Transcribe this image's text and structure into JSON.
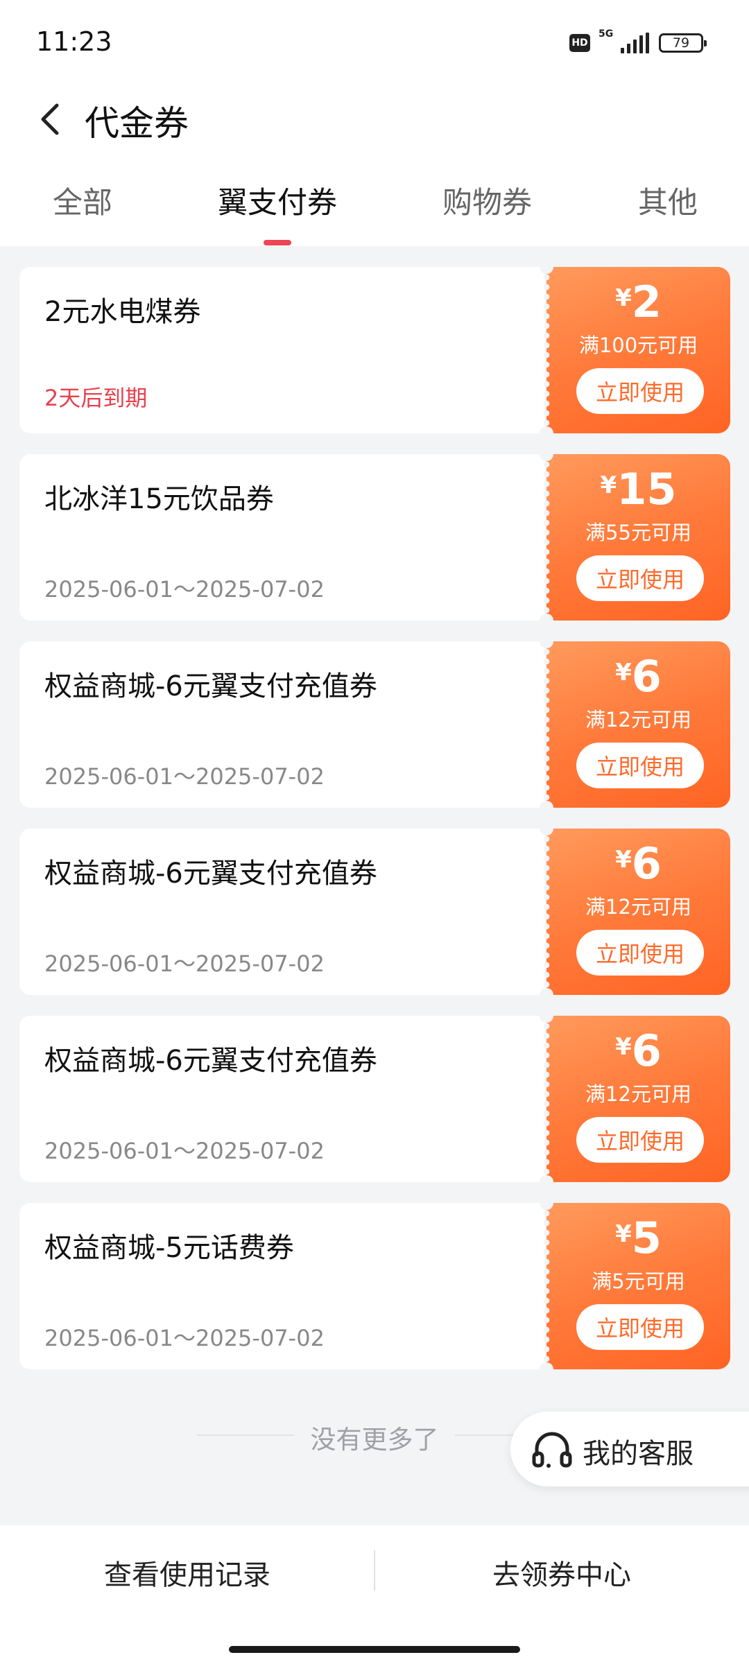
{
  "status_bar": {
    "time": "11:23",
    "network": "5G",
    "hd": "HD",
    "battery": "79"
  },
  "header": {
    "title": "代金券",
    "back_icon": "chevron-left-icon"
  },
  "tabs": [
    {
      "label": "全部"
    },
    {
      "label": "翼支付券",
      "active": true
    },
    {
      "label": "购物券"
    },
    {
      "label": "其他"
    }
  ],
  "colors": {
    "accent_orange": "#ff6a2a",
    "tab_indicator": "#ee4455",
    "expiring_red": "#e8404c"
  },
  "coupons": [
    {
      "name": "2元水电煤券",
      "date": "2天后到期",
      "currency": "¥",
      "amount": "2",
      "condition": "满100元可用",
      "button": "立即使用"
    },
    {
      "name": "北冰洋15元饮品券",
      "date": "2025-06-01～2025-07-02",
      "currency": "¥",
      "amount": "15",
      "condition": "满55元可用",
      "button": "立即使用"
    },
    {
      "name": "权益商城-6元翼支付充值券",
      "date": "2025-06-01～2025-07-02",
      "currency": "¥",
      "amount": "6",
      "condition": "满12元可用",
      "button": "立即使用"
    },
    {
      "name": "权益商城-6元翼支付充值券",
      "date": "2025-06-01～2025-07-02",
      "currency": "¥",
      "amount": "6",
      "condition": "满12元可用",
      "button": "立即使用"
    },
    {
      "name": "权益商城-6元翼支付充值券",
      "date": "2025-06-01～2025-07-02",
      "currency": "¥",
      "amount": "6",
      "condition": "满12元可用",
      "button": "立即使用"
    },
    {
      "name": "权益商城-5元话费券",
      "date": "2025-06-01～2025-07-02",
      "currency": "¥",
      "amount": "5",
      "condition": "满5元可用",
      "button": "立即使用"
    }
  ],
  "list_end_text": "没有更多了",
  "customer_service": {
    "label": "我的客服",
    "icon": "headset-icon"
  },
  "bottom_bar": {
    "history_label": "查看使用记录",
    "coupon_center_label": "去领券中心"
  }
}
